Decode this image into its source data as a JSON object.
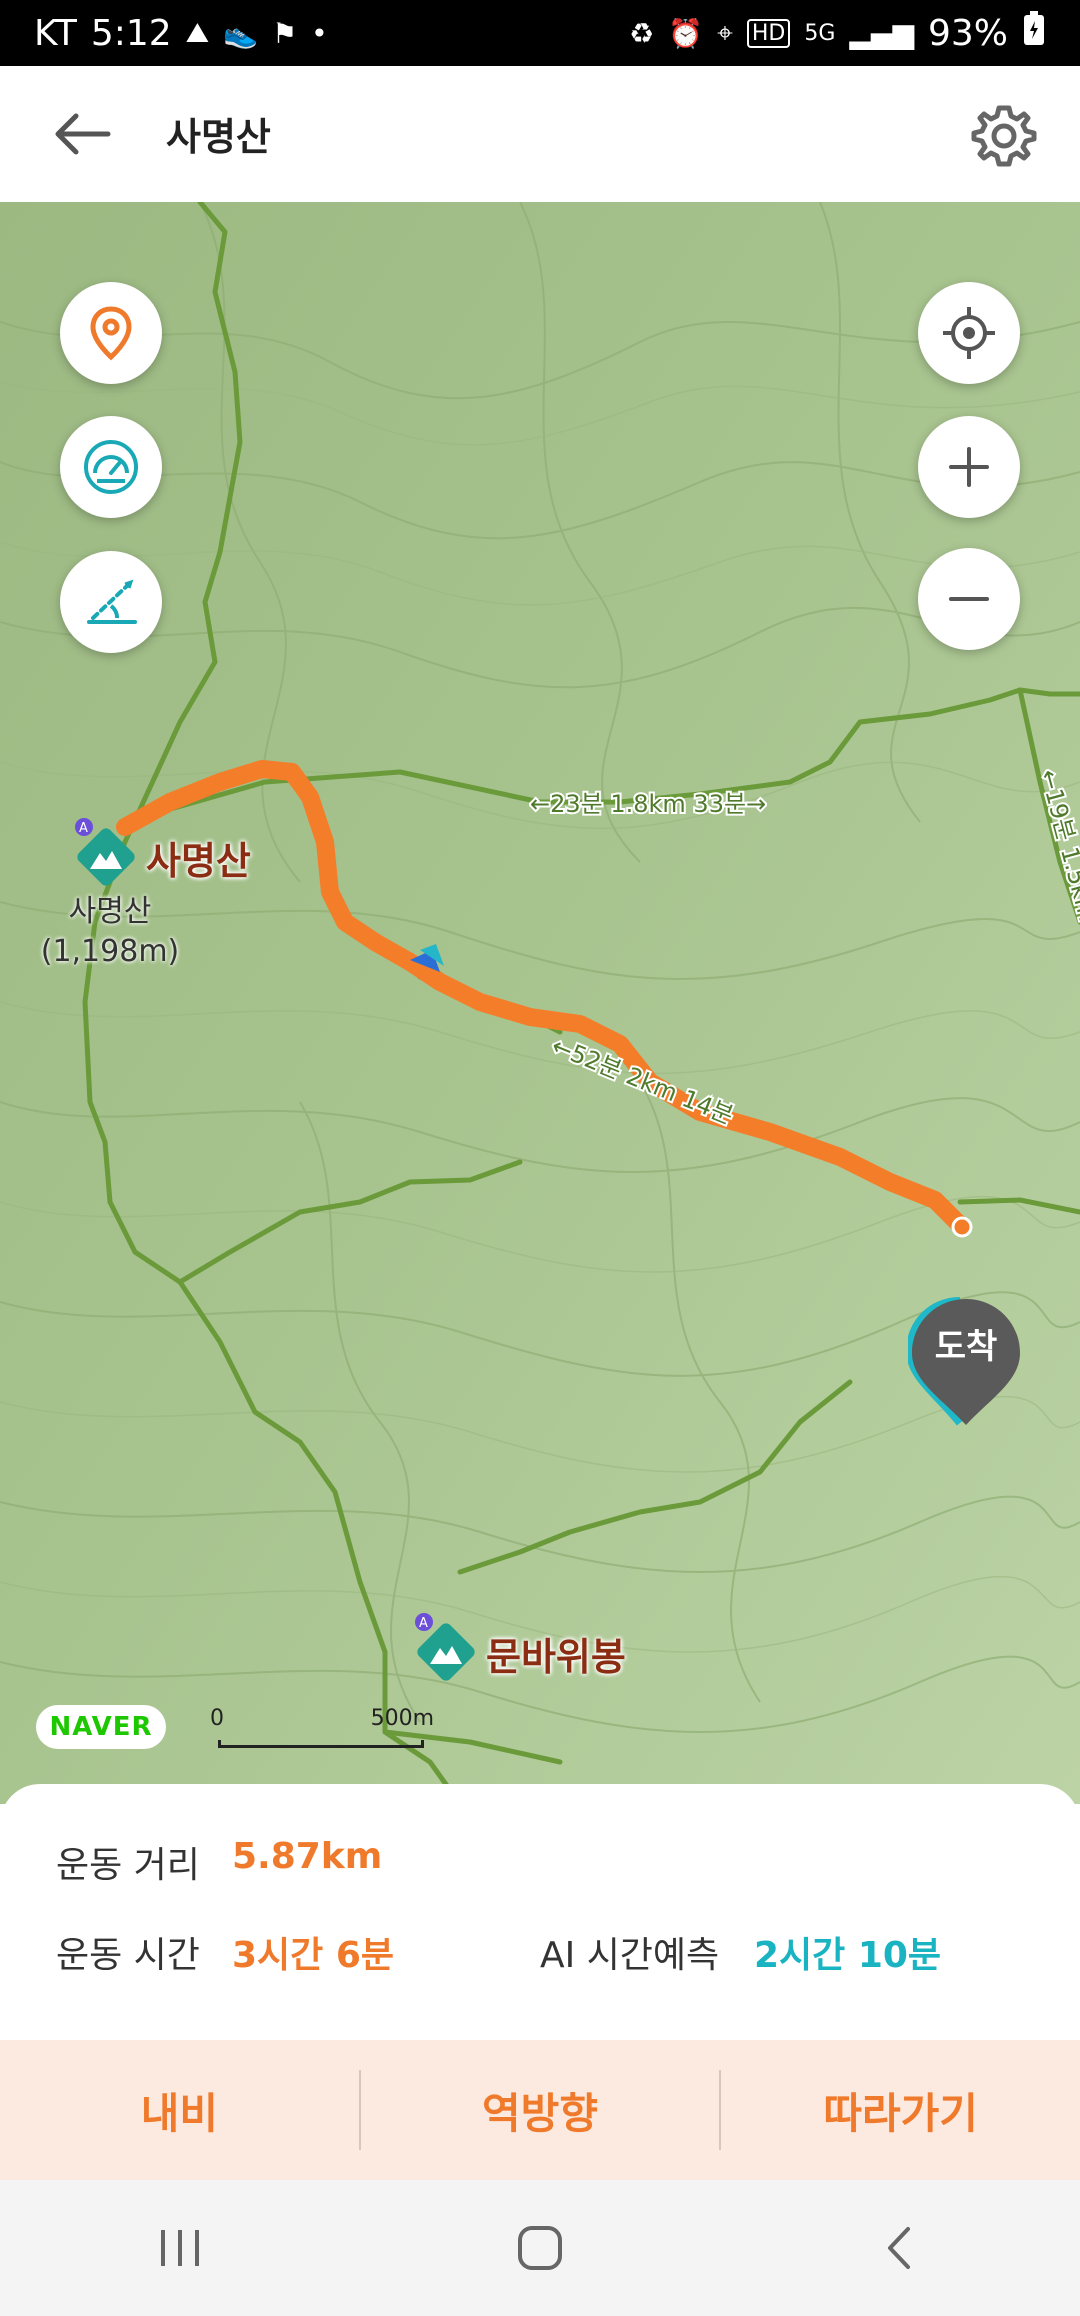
{
  "status_bar": {
    "carrier": "KT",
    "time": "5:12",
    "battery": "93%",
    "network": "5G",
    "hd": "HD"
  },
  "header": {
    "title": "사명산"
  },
  "map": {
    "peaks": [
      {
        "name": "사명산",
        "sub": "사명산",
        "elevation": "(1,198m)"
      },
      {
        "name": "문바위봉"
      }
    ],
    "trail_label_1": "←23분 1.8km 33분→",
    "trail_label_2": "←19분 1.5km",
    "trail_label_3": "←52분 2km 14분",
    "arrival_label": "도착",
    "brand": "NAVER",
    "scale": {
      "start": "0",
      "end": "500m"
    },
    "colors": {
      "route": "#f47d2a",
      "terrain": "#a9c390",
      "trail": "#6a9a3a"
    }
  },
  "stats": {
    "distance_label": "운동 거리",
    "distance_value": "5.87km",
    "time_label": "운동 시간",
    "time_value": "3시간 6분",
    "ai_label": "AI 시간예측",
    "ai_value": "2시간 10분",
    "accent_orange": "#f07a2c",
    "accent_teal": "#19b3c1"
  },
  "actions": {
    "navigate": "내비",
    "reverse": "역방향",
    "follow": "따라가기"
  },
  "icons": {
    "back": "arrow-left-icon",
    "settings": "gear-icon",
    "pin": "location-pin-icon",
    "speed": "speedometer-icon",
    "elevation": "elevation-profile-icon",
    "locate": "crosshair-icon",
    "zoom_in": "plus-icon",
    "zoom_out": "minus-icon"
  }
}
